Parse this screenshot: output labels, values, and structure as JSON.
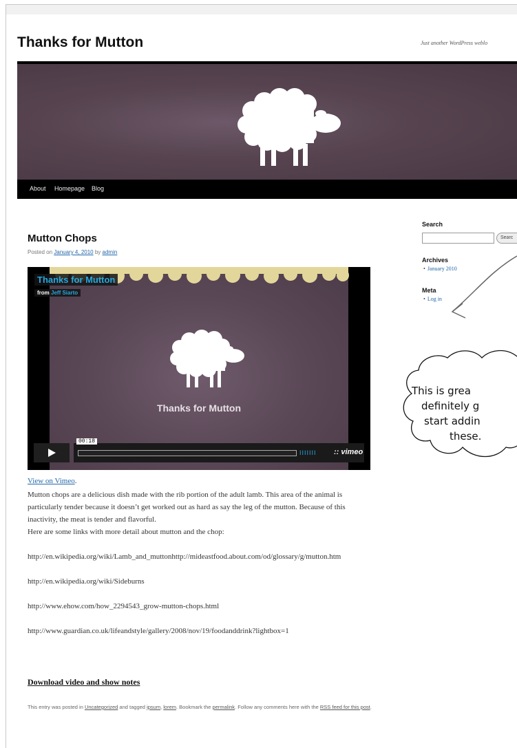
{
  "site": {
    "title": "Thanks for Mutton",
    "tagline": "Just another WordPress weblo",
    "nav": [
      "About",
      "Homepage",
      "Blog"
    ]
  },
  "post": {
    "title": "Mutton Chops",
    "meta_prefix": "Posted on ",
    "date": "January 4, 2010",
    "meta_by": " by ",
    "author": "admin",
    "video": {
      "title": "Thanks for Mutton",
      "from_label": "from ",
      "user": "Jeff Siarto",
      "caption": "Thanks for Mutton",
      "time": "00:18",
      "volume": "IIIIIII",
      "brand": ":: vimeo"
    },
    "view_on_vimeo": "View on Vimeo",
    "view_on_vimeo_suffix": ".",
    "body": "Mutton chops are a delicious dish made with the rib portion of the adult lamb. This area of the animal is particularly tender because it doesn’t get worked out as hard as say the leg of the mutton. Because of this inactivity, the meat is tender and flavorful.",
    "links_intro": "Here are some links with more detail about mutton and the chop:",
    "links": [
      "http://en.wikipedia.org/wiki/Lamb_and_muttonhttp://mideastfood.about.com/od/glossary/g/mutton.htm",
      "http://en.wikipedia.org/wiki/Sideburns",
      "http://www.ehow.com/how_2294543_grow-mutton-chops.html",
      "http://www.guardian.co.uk/lifeandstyle/gallery/2008/nov/19/foodanddrink?lightbox=1"
    ],
    "download": "Download video and show notes",
    "footer": {
      "t1": "This entry was posted in ",
      "category": "Uncategorized",
      "t2": " and tagged ",
      "tag1": "ipsum",
      "t3": ", ",
      "tag2": "lorem",
      "t4": ". Bookmark the ",
      "permalink": "permalink",
      "t5": ". Follow any comments here with the ",
      "rss": "RSS feed for this post",
      "t6": "."
    }
  },
  "sidebar": {
    "search_heading": "Search",
    "search_button": "Searc",
    "archives_heading": "Archives",
    "archives": [
      "January 2010"
    ],
    "meta_heading": "Meta",
    "meta": [
      "Log in"
    ]
  },
  "annotation": {
    "lines": [
      "This is grea",
      "definitely g",
      "start addin",
      "these."
    ]
  },
  "colors": {
    "banner": "#56434f",
    "vimeo_blue": "#26a8e0",
    "link": "#2266aa"
  }
}
